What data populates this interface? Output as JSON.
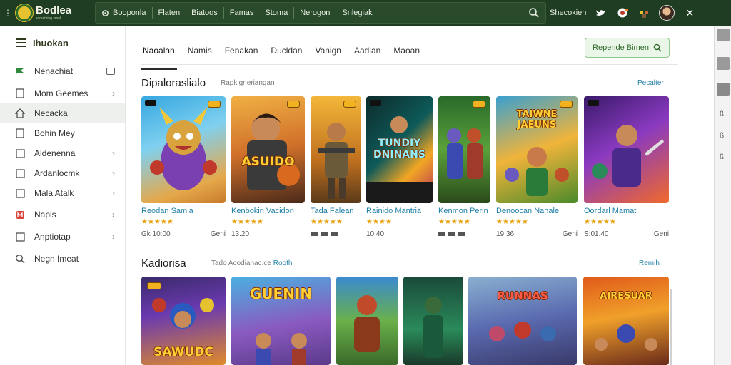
{
  "app": {
    "logo_name": "Bodlea",
    "logo_sub": "something small"
  },
  "topbar": {
    "nav": [
      "Booponla",
      "Flaten",
      "Biatoos",
      "Famas",
      "Stoma",
      "Nerogon",
      "Snlegiak"
    ],
    "right_label": "Shecokien"
  },
  "sidebar": {
    "header": "Ihuokan",
    "items": [
      {
        "label": "Nenachiat",
        "icon": "flag-icon"
      },
      {
        "label": "Mom Geemes",
        "icon": "bookmark-icon"
      },
      {
        "label": "Necacka",
        "icon": "home-icon"
      },
      {
        "label": "Bohin Mey",
        "icon": "bookmark-icon"
      },
      {
        "label": "Aldenenna",
        "icon": "checkbox-icon"
      },
      {
        "label": "Ardanlocmk",
        "icon": "checkbox-icon"
      },
      {
        "label": "Mala Atalk",
        "icon": "checkbox-icon"
      },
      {
        "label": "Napis",
        "icon": "app-icon"
      },
      {
        "label": "Anptiotap",
        "icon": "checkbox-icon"
      },
      {
        "label": "Negn Imeat",
        "icon": "search-icon"
      }
    ]
  },
  "tabs": [
    "Naoalan",
    "Namis",
    "Fenakan",
    "Ducldan",
    "Vanign",
    "Aadlan",
    "Maoan"
  ],
  "cta_label": "Repende Bimen",
  "section1": {
    "title": "Dipaloraslialo",
    "subtitle": "Rapkigneriangan",
    "link": "Pecalter",
    "cards": [
      {
        "title": "Reodan Samia",
        "stars": "★★★★★",
        "meta_left": "Gk 10:00",
        "meta_right": "Geni",
        "art": "hero-purple"
      },
      {
        "title": "Kenbokin Vacidon",
        "stars": "★★★★★",
        "meta_left": "13.20",
        "meta_right": "",
        "art": "basketball",
        "art_text": "ASUIDO"
      },
      {
        "title": "Tada Falean",
        "stars": "★★★★★",
        "meta_left": "",
        "meta_right": "",
        "art": "soldier"
      },
      {
        "title": "Rainido Mantria",
        "stars": "★★★★",
        "meta_left": "10:40",
        "meta_right": "",
        "art": "neon",
        "art_text": "TUNDIY DNINANS"
      },
      {
        "title": "Kenmon Perin",
        "stars": "★★★★★",
        "meta_left": "",
        "meta_right": "",
        "art": "squad"
      },
      {
        "title": "Denoocan Nanale",
        "stars": "★★★★★",
        "meta_left": "19:36",
        "meta_right": "Geni",
        "art": "jungle",
        "art_text": "TAIWNE JAEUNS"
      },
      {
        "title": "Oordarl Mamat",
        "stars": "★★★★★",
        "meta_left": "S:01.40",
        "meta_right": "Geni",
        "art": "warrior"
      }
    ]
  },
  "section2": {
    "title": "Kadiorisa",
    "subtitle": "Tado Acodianac.ce",
    "subtitle_highlight": "Rooth",
    "link": "Remih"
  },
  "row2": [
    {
      "art": "heroes-night",
      "art_text": "SAWUDC"
    },
    {
      "art": "heroes-sky",
      "art_text": "GUENIN"
    },
    {
      "art": "beast"
    },
    {
      "art": "forest"
    },
    {
      "art": "squad-red",
      "art_text": "RUNNAS"
    },
    {
      "art": "fire",
      "art_text": "AIRESUAR"
    }
  ]
}
